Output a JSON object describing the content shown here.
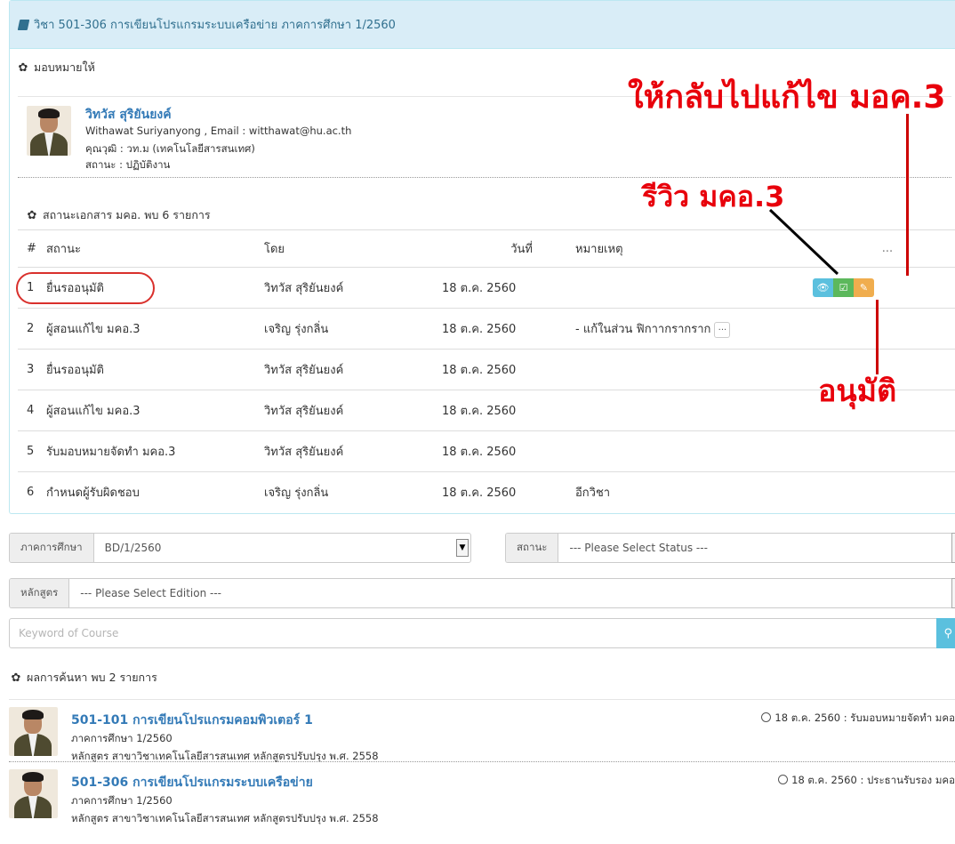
{
  "course_panel": {
    "heading": "วิชา 501-306 การเขียนโปรแกรมระบบเครือข่าย ภาคการศึกษา 1/2560",
    "assign_title": "มอบหมายให้",
    "profile": {
      "name": "วิทวัส สุริยันยงค์",
      "name_email": "Withawat Suriyanyong , Email : witthawat@hu.ac.th",
      "degree": "คุณวุฒิ : วท.ม (เทคโนโลยีสารสนเทศ)",
      "status": "สถานะ : ปฏิบัติงาน"
    },
    "doc_status_title": "สถานะเอกสาร มคอ. พบ 6 รายการ",
    "table": {
      "headers": [
        "#",
        "สถานะ",
        "โดย",
        "วันที่",
        "หมายเหตุ",
        "..."
      ],
      "rows": [
        {
          "num": "1",
          "status": "ยื่นรออนุมัติ",
          "by": "วิทวัส สุริยันยงค์",
          "date": "18 ต.ค. 2560",
          "note": ""
        },
        {
          "num": "2",
          "status": "ผู้สอนแก้ไข มคอ.3",
          "by": "เจริญ รุ่งกลิ่น",
          "date": "18 ต.ค. 2560",
          "note": "- แก้ในส่วน ฟิกาากรากราก"
        },
        {
          "num": "3",
          "status": "ยื่นรออนุมัติ",
          "by": "วิทวัส สุริยันยงค์",
          "date": "18 ต.ค. 2560",
          "note": ""
        },
        {
          "num": "4",
          "status": "ผู้สอนแก้ไข มคอ.3",
          "by": "วิทวัส สุริยันยงค์",
          "date": "18 ต.ค. 2560",
          "note": ""
        },
        {
          "num": "5",
          "status": "รับมอบหมายจัดทำ มคอ.3",
          "by": "วิทวัส สุริยันยงค์",
          "date": "18 ต.ค. 2560",
          "note": ""
        },
        {
          "num": "6",
          "status": "กำหนดผู้รับผิดชอบ",
          "by": "เจริญ รุ่งกลิ่น",
          "date": "18 ต.ค. 2560",
          "note": "อีกวิชา"
        }
      ],
      "note_more_label": "..."
    }
  },
  "annotations": {
    "return_to_edit": "ให้กลับไปแก้ไข มอค.3",
    "review": "รีวิว มคอ.3",
    "approve": "อนุมัติ"
  },
  "filters": {
    "semester_label": "ภาคการศึกษา",
    "semester_value": "BD/1/2560",
    "status_label": "สถานะ",
    "status_value": "--- Please Select Status ---",
    "curriculum_label": "หลักสูตร",
    "curriculum_value": "--- Please Select Edition ---",
    "search_placeholder": "Keyword of Course"
  },
  "results": {
    "title": "ผลการค้นหา พบ 2 รายการ",
    "items": [
      {
        "title": "501-101 การเขียนโปรแกรมคอมพิวเตอร์ 1",
        "semester": "ภาคการศึกษา 1/2560",
        "curriculum": "หลักสูตร สาขาวิชาเทคโนโลยีสารสนเทศ หลักสูตรปรับปรุง พ.ศ. 2558",
        "date_status": "18 ต.ค. 2560 : รับมอบหมายจัดทำ มคอ"
      },
      {
        "title": "501-306 การเขียนโปรแกรมระบบเครือข่าย",
        "semester": "ภาคการศึกษา 1/2560",
        "curriculum": "หลักสูตร สาขาวิชาเทคโนโลยีสารสนเทศ หลักสูตรปรับปรุง พ.ศ. 2558",
        "date_status": "18 ต.ค. 2560 : ประธานรับรอง มคอ"
      }
    ]
  },
  "colors": {
    "heading_bg": "#d9edf7",
    "link": "#337ab7",
    "annotation_red": "#e8000b",
    "btn_info": "#5bc0de",
    "btn_success": "#5cb85c",
    "btn_warning": "#f0ad4e"
  }
}
